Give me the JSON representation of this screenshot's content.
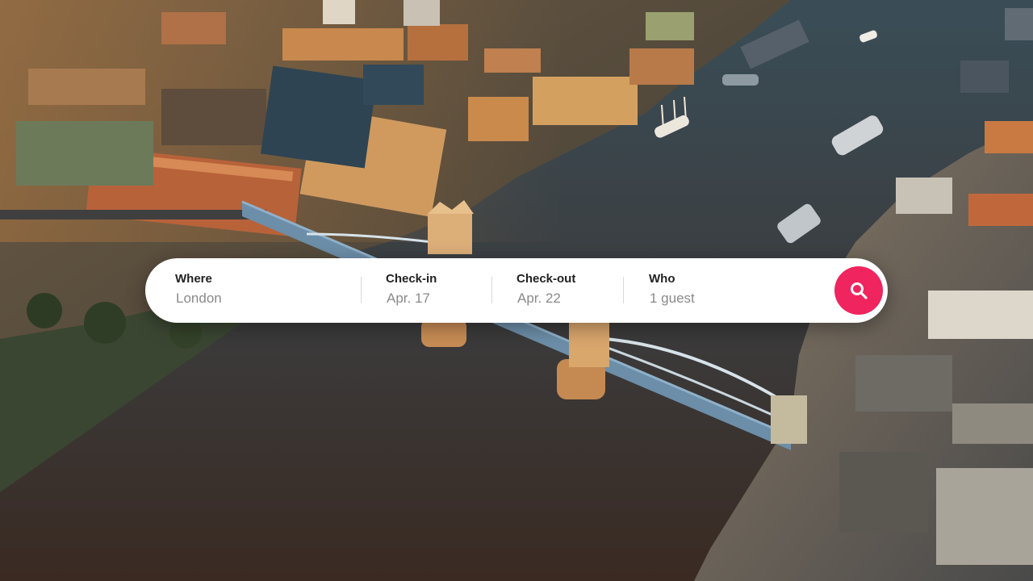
{
  "search": {
    "where": {
      "label": "Where",
      "value": "London"
    },
    "checkin": {
      "label": "Check-in",
      "value": "Apr. 17"
    },
    "checkout": {
      "label": "Check-out",
      "value": "Apr. 22"
    },
    "who": {
      "label": "Who",
      "value": "1 guest"
    },
    "button_icon": "search-icon"
  },
  "colors": {
    "accent": "#f0245e",
    "label": "#222222",
    "value": "#8a8a8a",
    "bar_background": "#ffffff"
  }
}
